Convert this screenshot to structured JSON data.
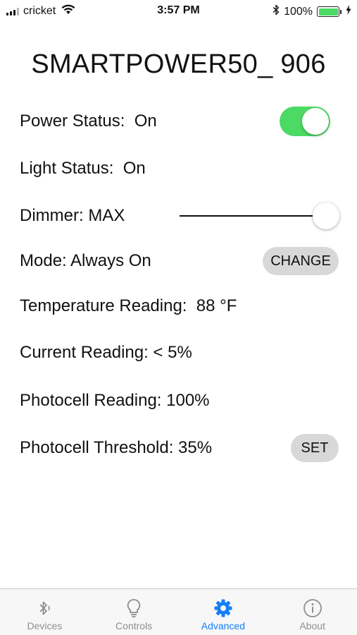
{
  "status_bar": {
    "carrier": "cricket",
    "time": "3:57 PM",
    "battery": "100%",
    "battery_level": 1.0,
    "battery_color": "#4cd964"
  },
  "title": "SMARTPOWER50_ 906",
  "rows": {
    "power_status": "Power Status:  On",
    "power_toggle_on": true,
    "light_status": "Light Status:  On",
    "dimmer": "Dimmer: MAX",
    "dimmer_level": 1.0,
    "mode": "Mode: Always On",
    "mode_button": "CHANGE",
    "temperature": "Temperature Reading:  88 °F",
    "current": "Current Reading: < 5%",
    "photocell": "Photocell Reading: 100%",
    "photocell_threshold": "Photocell Threshold: 35%",
    "set_button": "SET"
  },
  "tabs": [
    {
      "label": "Devices",
      "icon": "bluetooth-icon",
      "active": false
    },
    {
      "label": "Controls",
      "icon": "lightbulb-icon",
      "active": false
    },
    {
      "label": "Advanced",
      "icon": "gear-icon",
      "active": true
    },
    {
      "label": "About",
      "icon": "info-icon",
      "active": false
    }
  ],
  "colors": {
    "accent": "#147efb",
    "toggle_on": "#4cd964",
    "inactive_tab": "#8e8e93"
  }
}
